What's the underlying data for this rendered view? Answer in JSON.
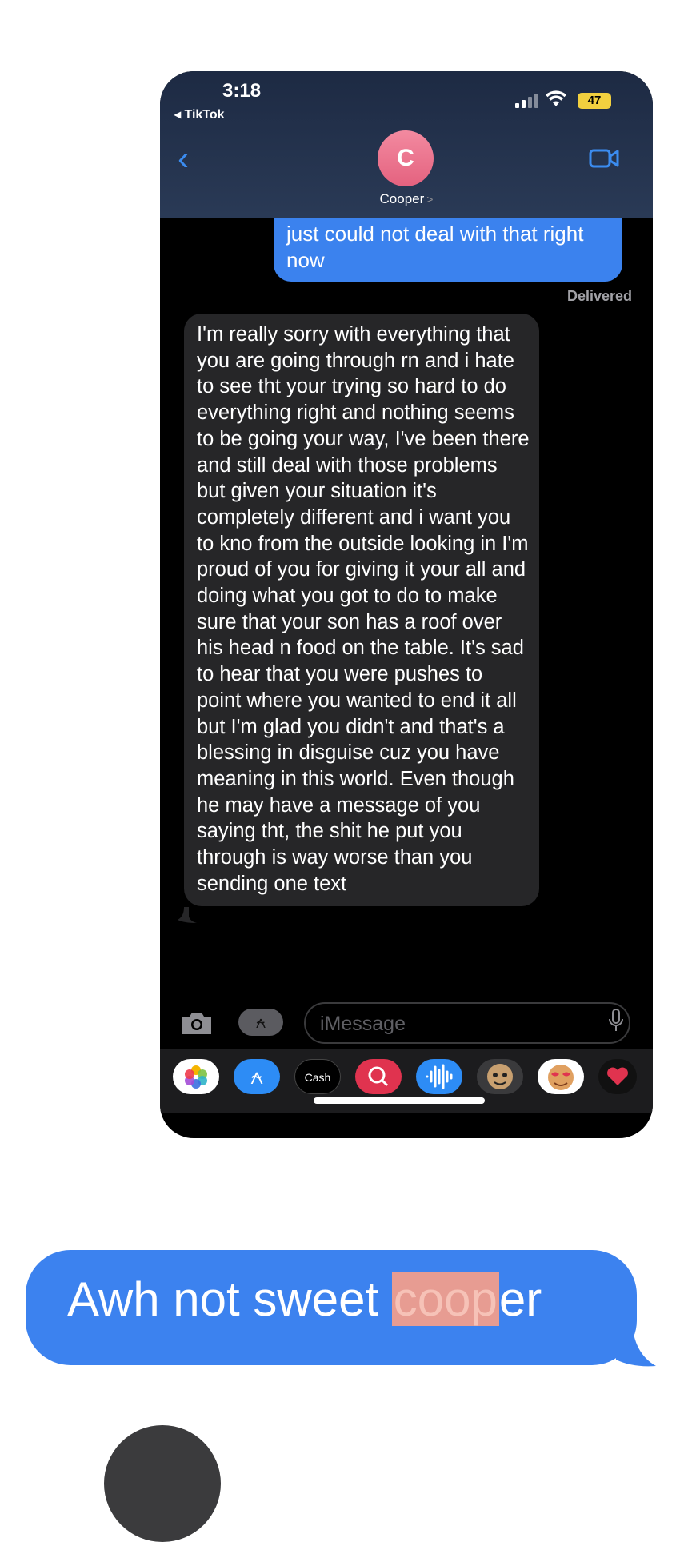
{
  "status_bar": {
    "time": "3:18",
    "back_app": "◂ TikTok",
    "battery": "47"
  },
  "header": {
    "avatar_initial": "C",
    "contact_name": "Cooper",
    "contact_chevron": ">"
  },
  "messages": {
    "sent_partial": "just could not deal with that right now",
    "delivered_label": "Delivered",
    "received": "I'm really sorry with everything that you are going through rn and i hate to see tht your trying so hard to do everything right and nothing seems to be going your way, I've been there and still deal with those problems but given your situation it's completely different and i want you to kno from the outside looking in I'm proud of you for giving it your all and doing what you got to do to make sure that your son has a roof over his head n food on the table. It's sad to hear that you were pushes to point where you wanted to end it all but I'm glad you didn't and that's a blessing in disguise cuz you have meaning in this world. Even though he may have a message of you saying tht, the shit he put you through is way worse than you sending one text"
  },
  "input": {
    "placeholder": "iMessage"
  },
  "app_tray": [
    {
      "icon": "photos-icon",
      "color": "#ffffff"
    },
    {
      "icon": "app-store-icon",
      "color": "#2d8cf5"
    },
    {
      "icon": "apple-cash-icon",
      "label": "Cash",
      "color": "#000000"
    },
    {
      "icon": "image-search-icon",
      "color": "#e0334f"
    },
    {
      "icon": "audio-message-icon",
      "color": "#2d8cf5"
    },
    {
      "icon": "memoji-icon",
      "color": "#8a6a3a"
    },
    {
      "icon": "memoji-stickers-icon",
      "color": "#ffffff"
    },
    {
      "icon": "digital-touch-icon",
      "color": "#e0334f"
    }
  ],
  "reply_bubble": {
    "text_before": "Awh not sweet ",
    "highlighted": "coop",
    "text_after": "er"
  },
  "colors": {
    "imessage_blue": "#3c82ef",
    "received_gray": "#262628",
    "highlight": "#e79c92"
  }
}
